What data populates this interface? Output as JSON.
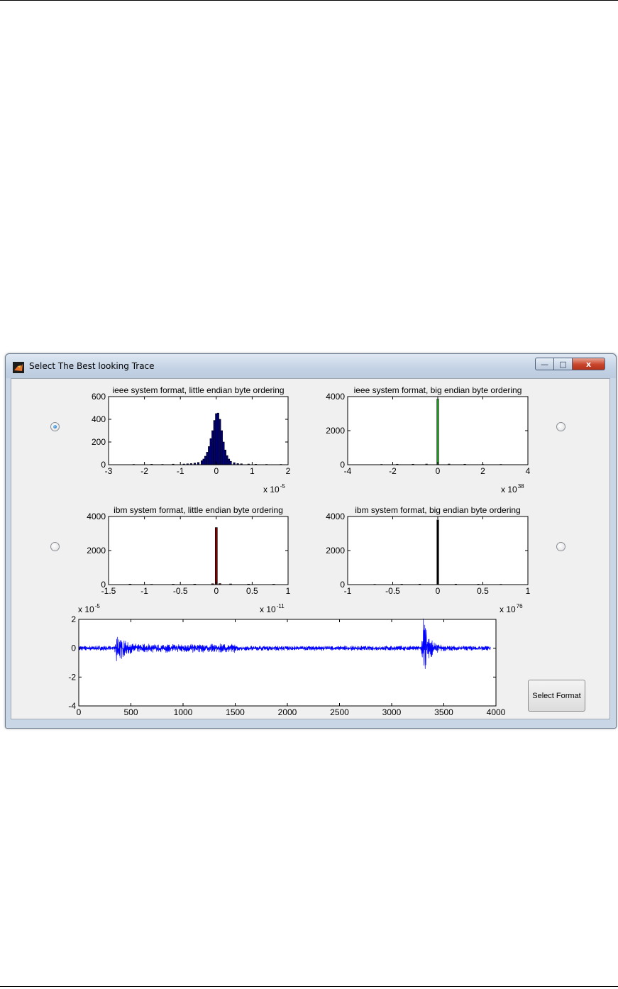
{
  "window": {
    "title": "Select The Best looking Trace",
    "buttons": {
      "minimize": "—",
      "maximize": "□",
      "close": "x"
    }
  },
  "radios": [
    {
      "checked": true
    },
    {
      "checked": false
    },
    {
      "checked": false
    },
    {
      "checked": false
    }
  ],
  "select_button_label": "Select Format",
  "colors": {
    "ieee_little": "#000080",
    "ieee_big": "#1e9e1e",
    "ibm_little": "#7a0000",
    "ibm_big": "#000000",
    "trace": "#0000ff"
  },
  "chart_data": [
    {
      "type": "bar",
      "title": "ieee system format, little endian byte ordering",
      "multiplier": "x 10",
      "exponent": "-5",
      "xlim": [
        -3,
        2
      ],
      "ylim": [
        0,
        600
      ],
      "xticks": [
        "-3",
        "-2",
        "-1",
        "0",
        "1",
        "2"
      ],
      "yticks": [
        "0",
        "200",
        "400",
        "600"
      ],
      "series": [
        {
          "color": "#000080",
          "bins": [
            [
              -2.3,
              3
            ],
            [
              -1.8,
              4
            ],
            [
              -1.5,
              3
            ],
            [
              -1.2,
              5
            ],
            [
              -0.9,
              6
            ],
            [
              -0.8,
              8
            ],
            [
              -0.7,
              10
            ],
            [
              -0.6,
              14
            ],
            [
              -0.5,
              20
            ],
            [
              -0.4,
              35
            ],
            [
              -0.35,
              50
            ],
            [
              -0.3,
              75
            ],
            [
              -0.25,
              110
            ],
            [
              -0.2,
              160
            ],
            [
              -0.15,
              230
            ],
            [
              -0.1,
              300
            ],
            [
              -0.05,
              390
            ],
            [
              0,
              450
            ],
            [
              0.05,
              455
            ],
            [
              0.1,
              400
            ],
            [
              0.15,
              300
            ],
            [
              0.2,
              200
            ],
            [
              0.25,
              130
            ],
            [
              0.3,
              80
            ],
            [
              0.35,
              50
            ],
            [
              0.4,
              30
            ],
            [
              0.5,
              18
            ],
            [
              0.6,
              10
            ],
            [
              0.7,
              8
            ],
            [
              0.9,
              6
            ],
            [
              1.1,
              4
            ],
            [
              1.4,
              3
            ],
            [
              1.8,
              3
            ]
          ],
          "width": 0.05
        }
      ]
    },
    {
      "type": "bar",
      "title": "ieee system format, big endian byte ordering",
      "multiplier": "x 10",
      "exponent": "38",
      "xlim": [
        -4,
        4
      ],
      "ylim": [
        0,
        4000
      ],
      "xticks": [
        "-4",
        "-2",
        "0",
        "2",
        "4"
      ],
      "yticks": [
        "0",
        "2000",
        "4000"
      ],
      "series": [
        {
          "color": "#1e9e1e",
          "bins": [
            [
              -2.5,
              20
            ],
            [
              -1.8,
              30
            ],
            [
              -1.1,
              30
            ],
            [
              -0.5,
              40
            ],
            [
              0,
              3850
            ],
            [
              0.5,
              40
            ],
            [
              1.2,
              30
            ],
            [
              2.0,
              20
            ],
            [
              2.8,
              20
            ]
          ],
          "width": 0.08
        }
      ]
    },
    {
      "type": "bar",
      "title": "ibm system format, little endian byte ordering",
      "multiplier": "x 10",
      "exponent": "-11",
      "xlim": [
        -1.5,
        1
      ],
      "ylim": [
        0,
        4000
      ],
      "xticks": [
        "-1.5",
        "-1",
        "-0.5",
        "0",
        "0.5",
        "1"
      ],
      "yticks": [
        "0",
        "2000",
        "4000"
      ],
      "series": [
        {
          "color": "#7a0000",
          "bins": [
            [
              -1.2,
              30
            ],
            [
              -0.9,
              20
            ],
            [
              -0.6,
              25
            ],
            [
              -0.3,
              30
            ],
            [
              -0.05,
              50
            ],
            [
              0,
              3350
            ],
            [
              0.05,
              60
            ],
            [
              0.2,
              40
            ],
            [
              0.45,
              30
            ],
            [
              0.8,
              25
            ]
          ],
          "width": 0.03
        }
      ]
    },
    {
      "type": "bar",
      "title": "ibm system format, big endian byte ordering",
      "multiplier": "x 10",
      "exponent": "76",
      "xlim": [
        -1,
        1
      ],
      "ylim": [
        0,
        4000
      ],
      "xticks": [
        "-1",
        "-0.5",
        "0",
        "0.5",
        "1"
      ],
      "yticks": [
        "0",
        "2000",
        "4000"
      ],
      "series": [
        {
          "color": "#000000",
          "bins": [
            [
              -0.7,
              20
            ],
            [
              -0.4,
              25
            ],
            [
              -0.2,
              30
            ],
            [
              0,
              3800
            ],
            [
              0.2,
              30
            ],
            [
              0.45,
              25
            ],
            [
              0.7,
              20
            ]
          ],
          "width": 0.02
        }
      ]
    },
    {
      "type": "line",
      "title": "",
      "multiplier": "x 10",
      "exponent": "-5",
      "xlim": [
        0,
        4000
      ],
      "ylim": [
        -4,
        2
      ],
      "xticks": [
        "0",
        "500",
        "1000",
        "1500",
        "2000",
        "2500",
        "3000",
        "3500",
        "4000"
      ],
      "yticks": [
        "-4",
        "-2",
        "0",
        "2"
      ],
      "series": [
        {
          "color": "#0000ff",
          "n_samples": 3950,
          "noise_level": 0.15,
          "events": [
            {
              "x": 360,
              "amplitude": 0.9
            },
            {
              "x": 3300,
              "amplitude": 1.9
            }
          ]
        }
      ]
    }
  ]
}
